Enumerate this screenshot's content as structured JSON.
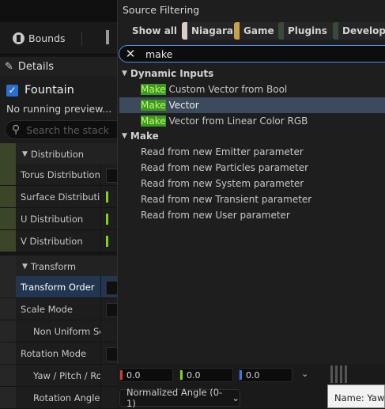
{
  "toolbar": {
    "bounds_label": "Bounds"
  },
  "details": {
    "title": "Details",
    "system_name": "Fountain",
    "preview_text": "No running preview...",
    "search_placeholder": "Search the stack"
  },
  "properties": [
    {
      "label": "Distribution",
      "kind": "section"
    },
    {
      "label": "Torus Distribution M",
      "kind": "row"
    },
    {
      "label": "Surface Distribution",
      "kind": "row"
    },
    {
      "label": "U Distribution",
      "kind": "row"
    },
    {
      "label": "V Distribution",
      "kind": "row"
    },
    {
      "label": "Transform",
      "kind": "section"
    },
    {
      "label": "Transform Order",
      "kind": "selected"
    },
    {
      "label": "Scale Mode",
      "kind": "row"
    },
    {
      "label": "Non Uniform Sca",
      "kind": "sub"
    },
    {
      "label": "Rotation Mode",
      "kind": "row"
    },
    {
      "label": "Yaw / Pitch / Ro",
      "kind": "sub"
    },
    {
      "label": "Rotation Angle T",
      "kind": "sub"
    }
  ],
  "popup": {
    "title": "Source Filtering",
    "chips": [
      {
        "label": "Show all",
        "color": ""
      },
      {
        "label": "Niagara",
        "color": "#d8cfc8"
      },
      {
        "label": "Game",
        "color": "#c8a24a"
      },
      {
        "label": "Plugins",
        "color": "#3a4a3a"
      },
      {
        "label": "Developer",
        "color": "#3a4a3a"
      }
    ],
    "search_value": "make",
    "categories": [
      {
        "name": "Dynamic Inputs",
        "items": [
          {
            "match": "Make",
            "rest": " Custom Vector from Bool"
          },
          {
            "match": "Make",
            "rest": " Vector",
            "selected": true
          },
          {
            "match": "Make",
            "rest": " Vector from Linear Color RGB"
          }
        ]
      },
      {
        "name": "Make",
        "items": [
          {
            "match": "",
            "rest": "Read from new Emitter parameter"
          },
          {
            "match": "",
            "rest": "Read from new Particles parameter"
          },
          {
            "match": "",
            "rest": "Read from new System parameter"
          },
          {
            "match": "",
            "rest": "Read from new Transient parameter"
          },
          {
            "match": "",
            "rest": "Read from new User parameter"
          }
        ]
      }
    ]
  },
  "values": [
    {
      "text": "0.0",
      "color": "#d23a3a"
    },
    {
      "text": "0.0",
      "color": "#7ed320"
    },
    {
      "text": "0.0",
      "color": "#3a78d8"
    }
  ],
  "dropdown_value": "Normalized Angle (0-1)",
  "tooltip_text": "Name: Yaw"
}
